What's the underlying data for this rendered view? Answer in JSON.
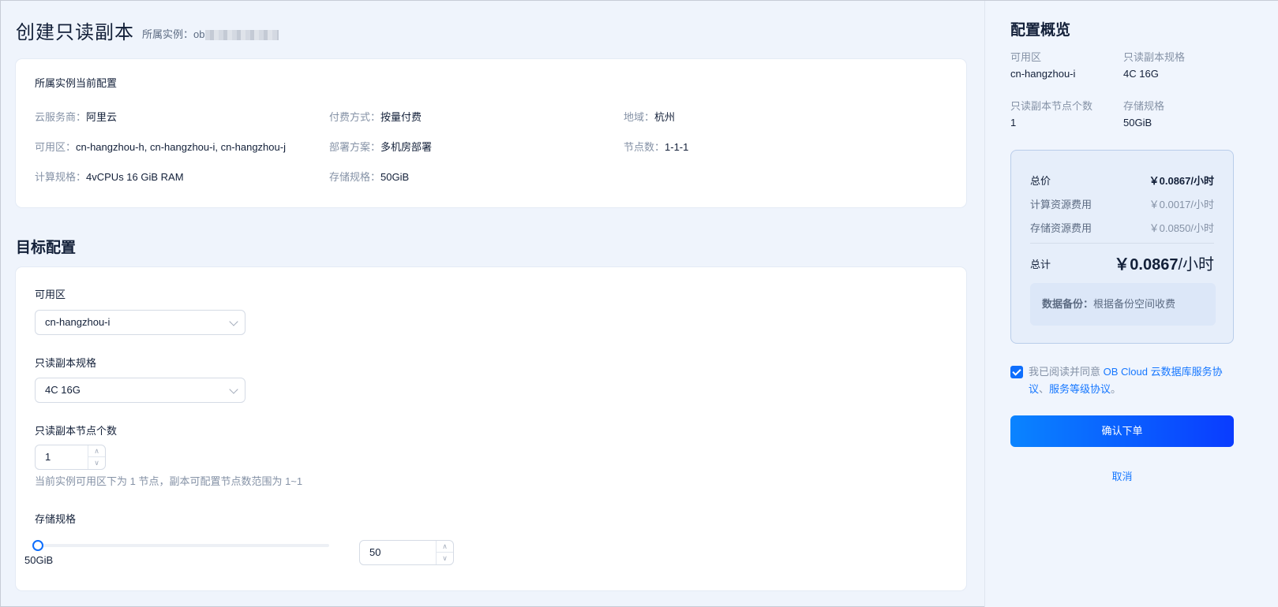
{
  "page": {
    "title": "创建只读副本",
    "instance_label": "所属实例：",
    "instance_value": "ob"
  },
  "current_config": {
    "title": "所属实例当前配置",
    "items": [
      {
        "key": "云服务商：",
        "value": "阿里云"
      },
      {
        "key": "付费方式：",
        "value": "按量付费"
      },
      {
        "key": "地域：",
        "value": "杭州"
      },
      {
        "key": "可用区：",
        "value": "cn-hangzhou-h, cn-hangzhou-i, cn-hangzhou-j"
      },
      {
        "key": "部署方案：",
        "value": "多机房部署"
      },
      {
        "key": "节点数：",
        "value": "1-1-1"
      },
      {
        "key": "计算规格：",
        "value": "4vCPUs 16 GiB RAM"
      },
      {
        "key": "存储规格：",
        "value": "50GiB"
      }
    ]
  },
  "target_config": {
    "title": "目标配置",
    "zone": {
      "label": "可用区",
      "value": "cn-hangzhou-i"
    },
    "spec": {
      "label": "只读副本规格",
      "value": "4C 16G"
    },
    "nodes": {
      "label": "只读副本节点个数",
      "value": "1",
      "hint": "当前实例可用区下为 1 节点，副本可配置节点数范围为 1~1"
    },
    "storage": {
      "label": "存储规格",
      "slider_min_label": "50GiB",
      "slider_level": 0,
      "value": "50"
    },
    "step_up_glyph": "∧",
    "step_down_glyph": "∨"
  },
  "summary": {
    "title": "配置概览",
    "zone_label": "可用区",
    "zone_value": "cn-hangzhou-i",
    "spec_label": "只读副本规格",
    "spec_value": "4C 16G",
    "nodes_label": "只读副本节点个数",
    "nodes_value": "1",
    "storage_label": "存储规格",
    "storage_value": "50GiB",
    "price": {
      "total_label": "总价",
      "total_value": "￥0.0867/小时",
      "compute_label": "计算资源费用",
      "compute_value": "￥0.0017/小时",
      "storage_label": "存储资源费用",
      "storage_value": "￥0.0850/小时",
      "sum_label": "总计",
      "sum_amount": "￥0.0867",
      "sum_unit": "/小时",
      "backup_key": "数据备份：",
      "backup_value": "根据备份空间收费"
    },
    "agreement": {
      "checked": true,
      "prefix": "我已阅读并同意 ",
      "link1": "OB Cloud 云数据库服务协议",
      "sep": "、",
      "link2": "服务等级协议",
      "suffix": "。"
    },
    "confirm_label": "确认下单",
    "cancel_label": "取消"
  },
  "colors": {
    "accent": "#0d6efd",
    "link": "#1677ff",
    "background": "#eff4fc"
  }
}
